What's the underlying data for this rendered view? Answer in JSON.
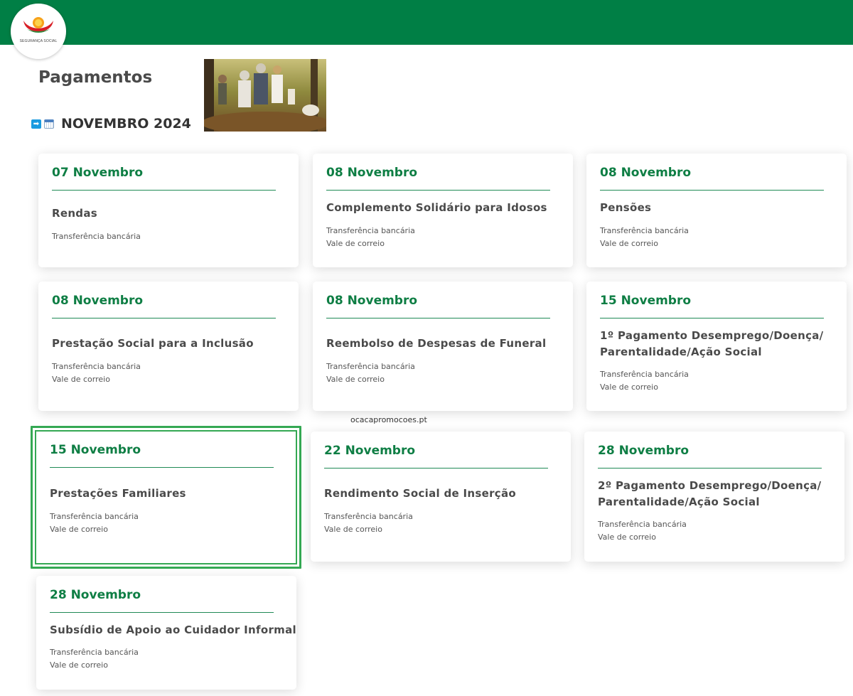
{
  "header": {
    "logo_text": "SEGURANÇA SOCIAL"
  },
  "page": {
    "title": "Pagamentos",
    "month": "NOVEMBRO 2024"
  },
  "watermark": "ocacapromocoes.pt",
  "colors": {
    "brand_green": "#007f45",
    "date_green": "#0e7e44",
    "highlight_green": "#34a853"
  },
  "icons": [
    "arrow-right-icon",
    "calendar-icon"
  ],
  "cards": [
    {
      "date": "07 Novembro",
      "title": "Rendas",
      "methods": [
        "Transferência bancária"
      ]
    },
    {
      "date": "08 Novembro",
      "title": "Complemento Solidário para Idosos",
      "methods": [
        "Transferência bancária",
        "Vale de correio"
      ]
    },
    {
      "date": "08 Novembro",
      "title": "Pensões",
      "methods": [
        "Transferência bancária",
        "Vale de correio"
      ]
    },
    {
      "date": "08 Novembro",
      "title": "Prestação Social para a Inclusão",
      "methods": [
        "Transferência bancária",
        "Vale de correio"
      ]
    },
    {
      "date": "08 Novembro",
      "title": "Reembolso de Despesas de Funeral",
      "methods": [
        "Transferência bancária",
        "Vale de correio"
      ]
    },
    {
      "date": "15 Novembro",
      "title_lines": [
        "1º Pagamento Desemprego/Doença/",
        "Parentalidade/Ação Social"
      ],
      "methods": [
        "Transferência bancária",
        "Vale de correio"
      ]
    },
    {
      "date": "15 Novembro",
      "title": "Prestações Familiares",
      "methods": [
        "Transferência bancária",
        "Vale de correio"
      ]
    },
    {
      "date": "22 Novembro",
      "title": "Rendimento Social de Inserção",
      "methods": [
        "Transferência bancária",
        "Vale de correio"
      ]
    },
    {
      "date": "28 Novembro",
      "title_lines": [
        "2º Pagamento Desemprego/Doença/",
        "Parentalidade/Ação Social"
      ],
      "methods": [
        "Transferência bancária",
        "Vale de correio"
      ]
    },
    {
      "date": "28 Novembro",
      "title": "Subsídio de Apoio ao Cuidador Informal",
      "methods": [
        "Transferência bancária",
        "Vale de correio"
      ]
    }
  ]
}
